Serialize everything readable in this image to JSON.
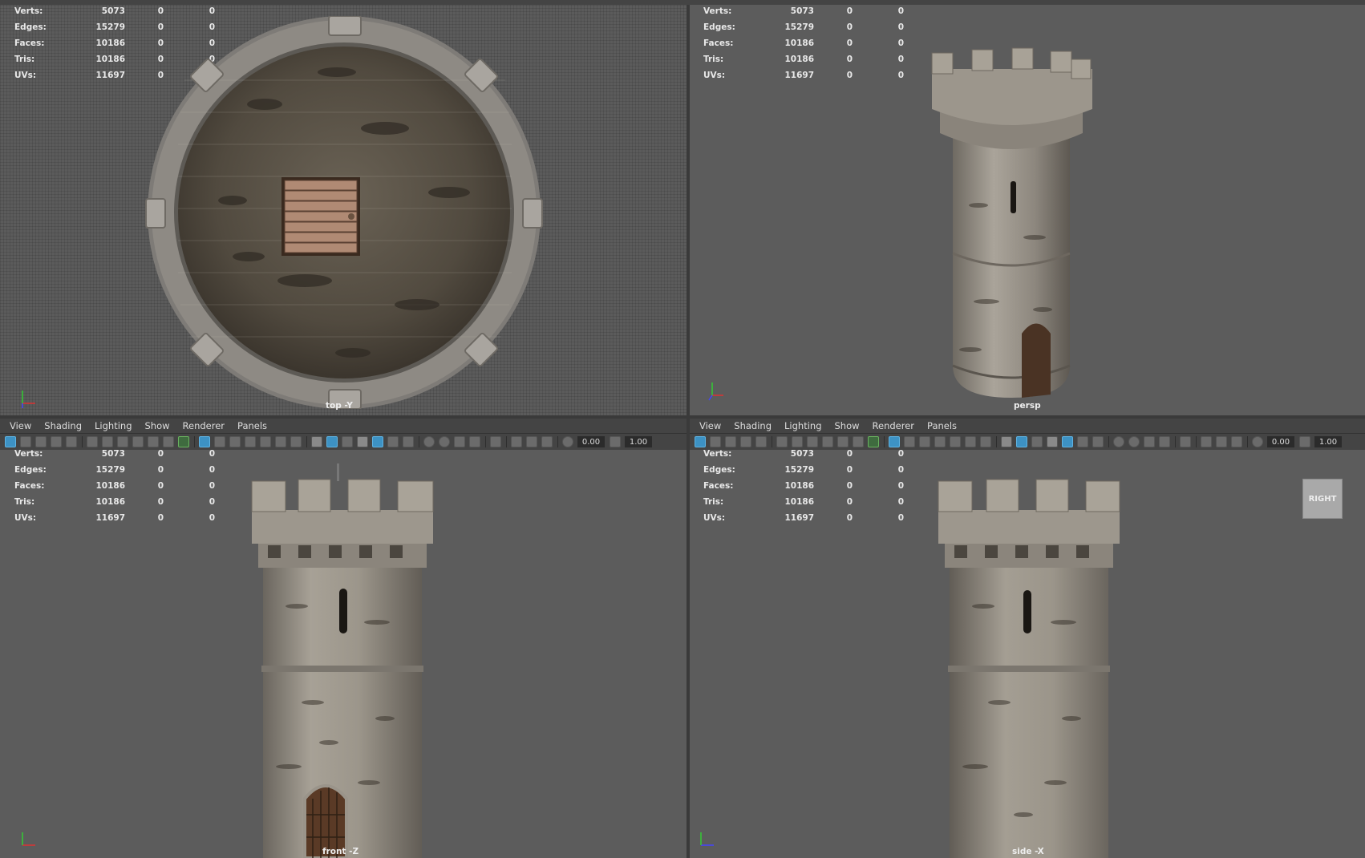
{
  "menu": [
    "View",
    "Shading",
    "Lighting",
    "Show",
    "Renderer",
    "Panels"
  ],
  "hud": [
    {
      "label": "Verts:",
      "values": [
        "5073",
        "0",
        "0"
      ]
    },
    {
      "label": "Edges:",
      "values": [
        "15279",
        "0",
        "0"
      ]
    },
    {
      "label": "Faces:",
      "values": [
        "10186",
        "0",
        "0"
      ]
    },
    {
      "label": "Tris:",
      "values": [
        "10186",
        "0",
        "0"
      ]
    },
    {
      "label": "UVs:",
      "values": [
        "11697",
        "0",
        "0"
      ]
    }
  ],
  "toolbar": {
    "exposure": "0.00",
    "gamma": "1.00"
  },
  "viewports": {
    "top": {
      "camera": "top -Y"
    },
    "persp": {
      "camera": "persp"
    },
    "front": {
      "camera": "front -Z"
    },
    "side": {
      "camera": "side -X"
    }
  },
  "viewcube": {
    "label": "RIGHT"
  },
  "colors": {
    "viewport_bg": "#5c5c5c",
    "ui_bg": "#444444",
    "active_icon": "#3d92c4",
    "stone": "#8a8378"
  }
}
